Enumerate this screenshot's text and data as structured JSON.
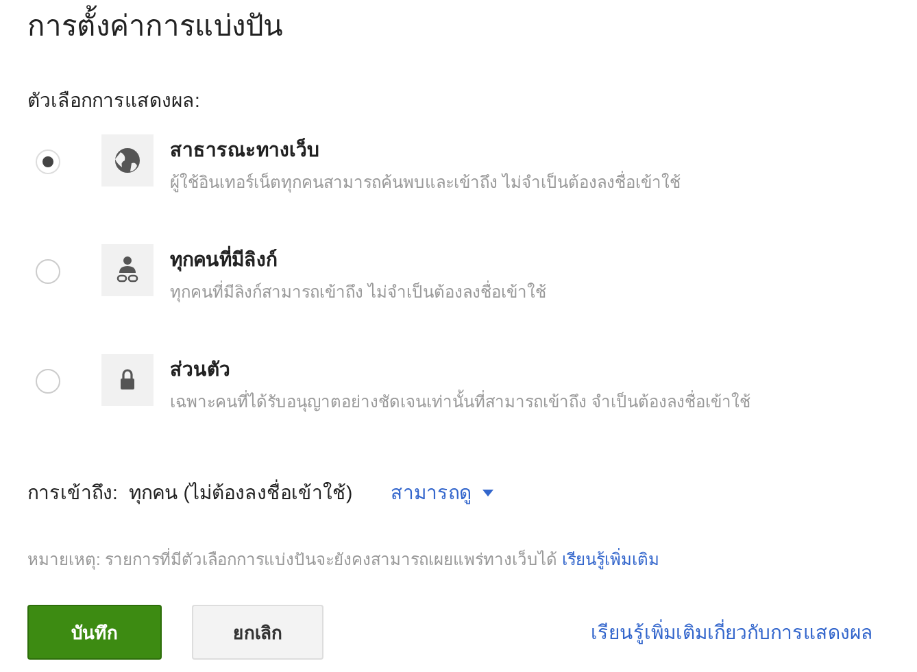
{
  "title": "การตั้งค่าการแบ่งปัน",
  "section_label": "ตัวเลือกการแสดงผล:",
  "options": [
    {
      "kind": "globe",
      "label": "สาธารณะทางเว็บ",
      "description": "ผู้ใช้อินเทอร์เน็ตทุกคนสามารถค้นพบและเข้าถึง ไม่จำเป็นต้องลงชื่อเข้าใช้",
      "selected": true
    },
    {
      "kind": "link",
      "label": "ทุกคนที่มีลิงก์",
      "description": "ทุกคนที่มีลิงก์สามารถเข้าถึง ไม่จำเป็นต้องลงชื่อเข้าใช้",
      "selected": false
    },
    {
      "kind": "lock",
      "label": "ส่วนตัว",
      "description": "เฉพาะคนที่ได้รับอนุญาตอย่างชัดเจนเท่านั้นที่สามารถเข้าถึง จำเป็นต้องลงชื่อเข้าใช้",
      "selected": false
    }
  ],
  "access": {
    "label": "การเข้าถึง:",
    "value": "ทุกคน (ไม่ต้องลงชื่อเข้าใช้)",
    "permission": "สามารถดู"
  },
  "note": {
    "text": "หมายเหตุ: รายการที่มีตัวเลือกการแบ่งปันจะยังคงสามารถเผยแพร่ทางเว็บได้",
    "link": "เรียนรู้เพิ่มเติม"
  },
  "buttons": {
    "save": "บันทึก",
    "cancel": "ยกเลิก"
  },
  "help_link": "เรียนรู้เพิ่มเติมเกี่ยวกับการแสดงผล"
}
